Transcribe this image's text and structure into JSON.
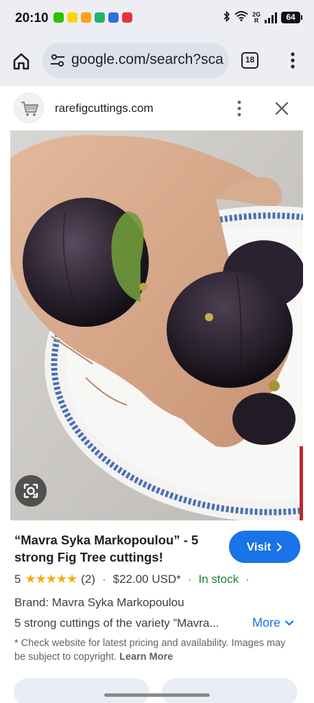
{
  "status_bar": {
    "time": "20:10",
    "network_label_top": "2G",
    "network_label_bottom": "R",
    "battery": "64"
  },
  "browser": {
    "url": "google.com/search?sca",
    "tab_count": "18"
  },
  "site": {
    "domain": "rarefigcuttings.com"
  },
  "product": {
    "title": "“Mavra Syka Markopoulou” - 5 strong Fig Tree cuttings!",
    "visit_label": "Visit",
    "rating_value": "5",
    "stars": "★★★★★",
    "review_count": "(2)",
    "separator": "·",
    "price": "$22.00 USD*",
    "availability": "In stock",
    "brand": "Brand: Mavra Syka Markopoulou",
    "description": "5 strong cuttings of the variety ”Mavra...",
    "more_label": "More",
    "disclaimer": "* Check website for latest pricing and availability. Images may be subject to copyright.",
    "learn_more": "Learn More"
  },
  "colors": {
    "accent": "#1a73e8",
    "in_stock": "#188038",
    "star": "#f9ab00",
    "chrome_bg": "#eceef4"
  },
  "icons": [
    "home-icon",
    "tune-icon",
    "tabs-icon",
    "more-vert-icon",
    "close-icon",
    "cart-favicon-icon",
    "google-lens-icon",
    "chevron-right-icon",
    "chevron-down-icon",
    "bluetooth-icon",
    "wifi-icon",
    "signal-icon",
    "battery-icon"
  ]
}
